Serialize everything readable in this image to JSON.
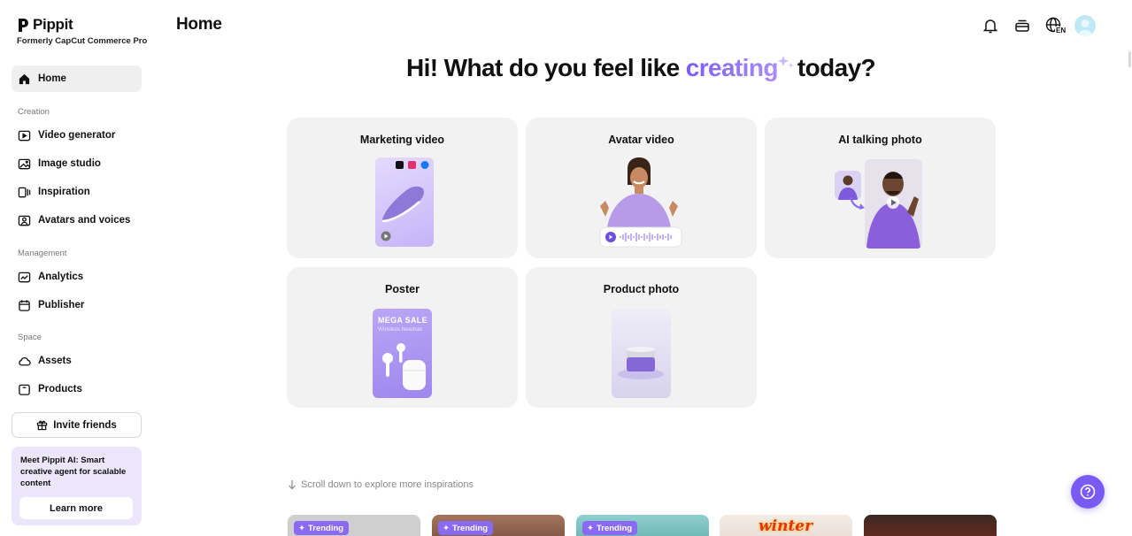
{
  "brand": {
    "name": "Pippit",
    "subtitle": "Formerly CapCut Commerce Pro"
  },
  "header": {
    "title": "Home",
    "language": "EN",
    "icons": [
      "bell-icon",
      "inbox-icon",
      "globe-icon"
    ]
  },
  "sidebar": {
    "home": "Home",
    "sections": {
      "creation": "Creation",
      "management": "Management",
      "space": "Space"
    },
    "creation_items": [
      "Video generator",
      "Image studio",
      "Inspiration",
      "Avatars and voices"
    ],
    "management_items": [
      "Analytics",
      "Publisher"
    ],
    "space_items": [
      "Assets",
      "Products"
    ],
    "invite": "Invite friends",
    "promo": {
      "text": "Meet Pippit AI: Smart creative agent for scalable content",
      "button": "Learn more"
    }
  },
  "hero": {
    "prefix": "Hi! What do you feel like",
    "accent": "creating",
    "suffix": "today?"
  },
  "cards": [
    "Marketing video",
    "Avatar video",
    "AI talking photo",
    "Poster",
    "Product photo"
  ],
  "poster": {
    "headline": "MEGA SALE",
    "subline": "Wireless headset"
  },
  "scroll_hint": "Scroll down to explore more inspirations",
  "inspirations": {
    "tag": "Trending",
    "winter_text": "winter"
  },
  "colors": {
    "accent": "#7a5af5",
    "card_bg": "#f2f2f2",
    "promo_bg": "#ece6fb"
  }
}
